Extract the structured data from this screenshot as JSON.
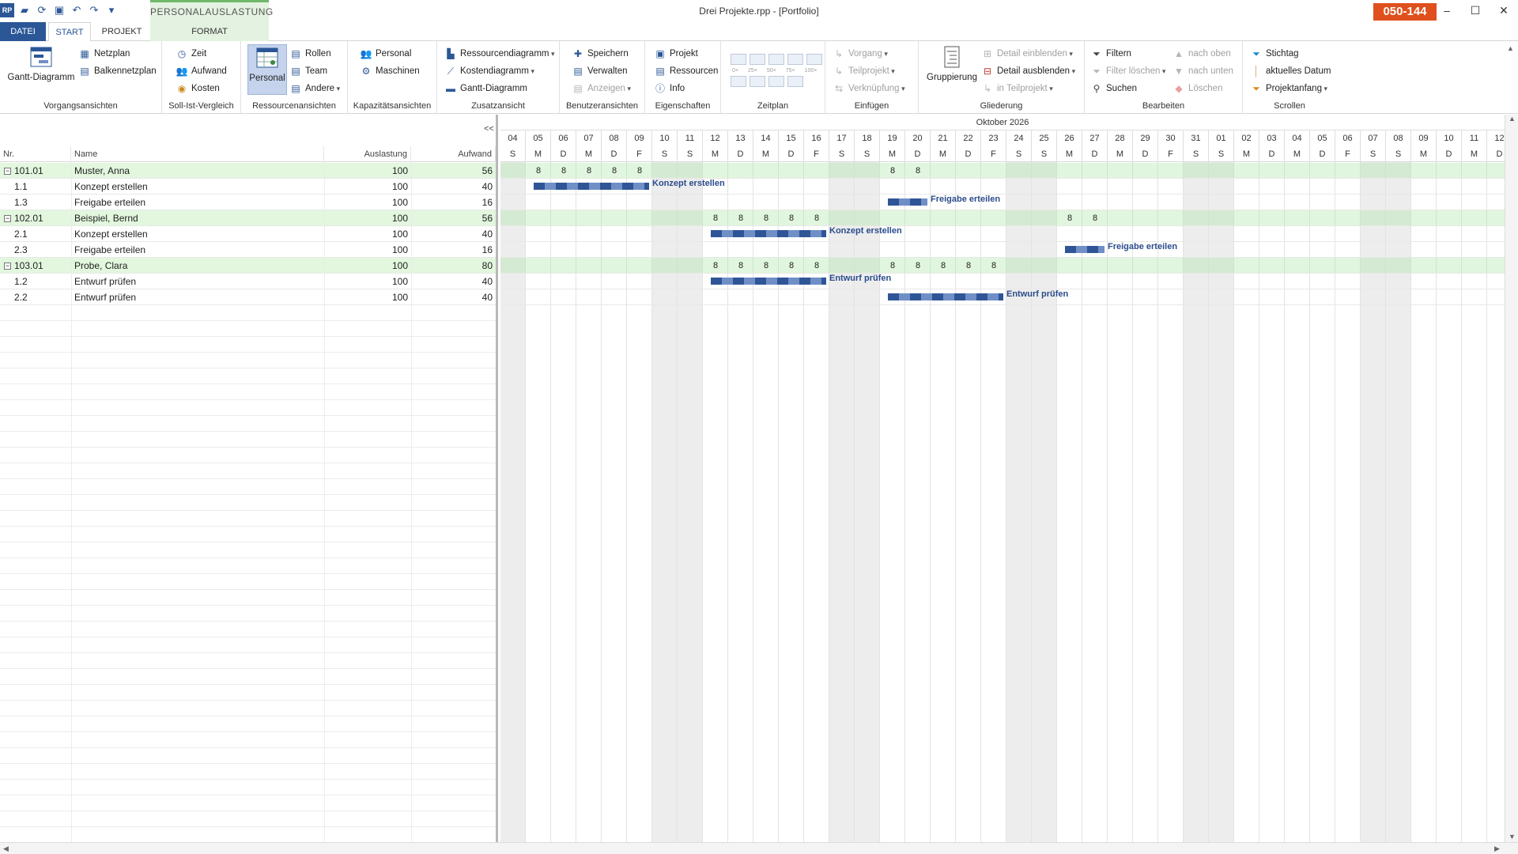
{
  "window": {
    "title": "Drei Projekte.rpp - [Portfolio]",
    "badge": "050-144",
    "minimize": "–",
    "maximize": "☐",
    "close": "✕"
  },
  "context_tab": "PERSONALAUSLASTUNG",
  "tabs": [
    "DATEI",
    "START",
    "PROJEKT",
    "FORMAT"
  ],
  "ribbon": {
    "vorgangsansichten": {
      "label": "Vorgangsansichten",
      "gantt": "Gantt-Diagramm",
      "netzplan": "Netzplan",
      "balkennetzplan": "Balkennetzplan"
    },
    "sollist": {
      "label": "Soll-Ist-Vergleich",
      "zeit": "Zeit",
      "aufwand": "Aufwand",
      "kosten": "Kosten"
    },
    "ressourcen": {
      "label": "Ressourcenansichten",
      "personal": "Personal",
      "rollen": "Rollen",
      "team": "Team",
      "andere": "Andere"
    },
    "kapazitaet": {
      "label": "Kapazitätsansichten",
      "personal": "Personal",
      "maschinen": "Maschinen"
    },
    "zusatz": {
      "label": "Zusatzansicht",
      "ressourcendiagramm": "Ressourcendiagramm",
      "kostendiagramm": "Kostendiagramm",
      "gantt": "Gantt-Diagramm"
    },
    "benutzer": {
      "label": "Benutzeransichten",
      "speichern": "Speichern",
      "verwalten": "Verwalten",
      "anzeigen": "Anzeigen"
    },
    "eigenschaften": {
      "label": "Eigenschaften",
      "projekt": "Projekt",
      "ressourcen": "Ressourcen",
      "info": "Info"
    },
    "zeitplan": {
      "label": "Zeitplan",
      "zoom": [
        "0×",
        "25×",
        "50×",
        "75×",
        "100×"
      ]
    },
    "einfuegen": {
      "label": "Einfügen",
      "vorgang": "Vorgang",
      "teilprojekt": "Teilprojekt",
      "verknuepfung": "Verknüpfung"
    },
    "gliederung": {
      "label": "Gliederung",
      "gruppierung": "Gruppierung",
      "detail_ein": "Detail einblenden",
      "detail_aus": "Detail ausblenden",
      "in_teilprojekt": "in Teilprojekt"
    },
    "bearbeiten": {
      "label": "Bearbeiten",
      "filtern": "Filtern",
      "filter_loeschen": "Filter löschen",
      "suchen": "Suchen",
      "nach_oben": "nach oben",
      "nach_unten": "nach unten",
      "loeschen": "Löschen"
    },
    "scrollen": {
      "label": "Scrollen",
      "stichtag": "Stichtag",
      "aktuelles_datum": "aktuelles Datum",
      "projektanfang": "Projektanfang"
    }
  },
  "table": {
    "collapse_label": "<<",
    "headers": {
      "nr": "Nr.",
      "name": "Name",
      "auslastung": "Auslastung",
      "aufwand": "Aufwand"
    },
    "rows": [
      {
        "nr": "101.01",
        "name": "Muster, Anna",
        "auslastung": "100",
        "aufwand": "56",
        "kind": "resource"
      },
      {
        "nr": "1.1",
        "name": "Konzept erstellen",
        "auslastung": "100",
        "aufwand": "40",
        "kind": "task"
      },
      {
        "nr": "1.3",
        "name": "Freigabe erteilen",
        "auslastung": "100",
        "aufwand": "16",
        "kind": "task"
      },
      {
        "nr": "102.01",
        "name": "Beispiel, Bernd",
        "auslastung": "100",
        "aufwand": "56",
        "kind": "resource"
      },
      {
        "nr": "2.1",
        "name": "Konzept erstellen",
        "auslastung": "100",
        "aufwand": "40",
        "kind": "task"
      },
      {
        "nr": "2.3",
        "name": "Freigabe erteilen",
        "auslastung": "100",
        "aufwand": "16",
        "kind": "task"
      },
      {
        "nr": "103.01",
        "name": "Probe, Clara",
        "auslastung": "100",
        "aufwand": "80",
        "kind": "resource"
      },
      {
        "nr": "1.2",
        "name": "Entwurf prüfen",
        "auslastung": "100",
        "aufwand": "40",
        "kind": "task"
      },
      {
        "nr": "2.2",
        "name": "Entwurf prüfen",
        "auslastung": "100",
        "aufwand": "40",
        "kind": "task"
      }
    ]
  },
  "gantt": {
    "month_label": "Oktober 2026",
    "days": [
      {
        "n": "04",
        "d": "S"
      },
      {
        "n": "05",
        "d": "M"
      },
      {
        "n": "06",
        "d": "D"
      },
      {
        "n": "07",
        "d": "M"
      },
      {
        "n": "08",
        "d": "D"
      },
      {
        "n": "09",
        "d": "F"
      },
      {
        "n": "10",
        "d": "S"
      },
      {
        "n": "11",
        "d": "S"
      },
      {
        "n": "12",
        "d": "M"
      },
      {
        "n": "13",
        "d": "D"
      },
      {
        "n": "14",
        "d": "M"
      },
      {
        "n": "15",
        "d": "D"
      },
      {
        "n": "16",
        "d": "F"
      },
      {
        "n": "17",
        "d": "S"
      },
      {
        "n": "18",
        "d": "S"
      },
      {
        "n": "19",
        "d": "M"
      },
      {
        "n": "20",
        "d": "D"
      },
      {
        "n": "21",
        "d": "M"
      },
      {
        "n": "22",
        "d": "D"
      },
      {
        "n": "23",
        "d": "F"
      },
      {
        "n": "24",
        "d": "S"
      },
      {
        "n": "25",
        "d": "S"
      },
      {
        "n": "26",
        "d": "M"
      },
      {
        "n": "27",
        "d": "D"
      },
      {
        "n": "28",
        "d": "M"
      },
      {
        "n": "29",
        "d": "D"
      },
      {
        "n": "30",
        "d": "F"
      },
      {
        "n": "31",
        "d": "S"
      },
      {
        "n": "01",
        "d": "S"
      },
      {
        "n": "02",
        "d": "M"
      },
      {
        "n": "03",
        "d": "D"
      },
      {
        "n": "04",
        "d": "M"
      },
      {
        "n": "05",
        "d": "D"
      },
      {
        "n": "06",
        "d": "F"
      },
      {
        "n": "07",
        "d": "S"
      },
      {
        "n": "08",
        "d": "S"
      },
      {
        "n": "09",
        "d": "M"
      },
      {
        "n": "10",
        "d": "D"
      },
      {
        "n": "11",
        "d": "M"
      },
      {
        "n": "12",
        "d": "D"
      }
    ],
    "hours": [
      {
        "row": 0,
        "days": [
          1,
          2,
          3,
          4,
          5,
          15,
          16
        ],
        "value": "8"
      },
      {
        "row": 3,
        "days": [
          8,
          9,
          10,
          11,
          12,
          22,
          23
        ],
        "value": "8"
      },
      {
        "row": 6,
        "days": [
          8,
          9,
          10,
          11,
          12,
          15,
          16,
          17,
          18,
          19
        ],
        "value": "8"
      }
    ],
    "bars": [
      {
        "row": 1,
        "start": 1,
        "end": 5,
        "label": "Konzept erstellen"
      },
      {
        "row": 2,
        "start": 15,
        "end": 16,
        "label": "Freigabe erteilen"
      },
      {
        "row": 4,
        "start": 8,
        "end": 12,
        "label": "Konzept erstellen"
      },
      {
        "row": 5,
        "start": 22,
        "end": 23,
        "label": "Freigabe erteilen"
      },
      {
        "row": 7,
        "start": 8,
        "end": 12,
        "label": "Entwurf prüfen"
      },
      {
        "row": 8,
        "start": 15,
        "end": 19,
        "label": "Entwurf prüfen"
      }
    ]
  }
}
